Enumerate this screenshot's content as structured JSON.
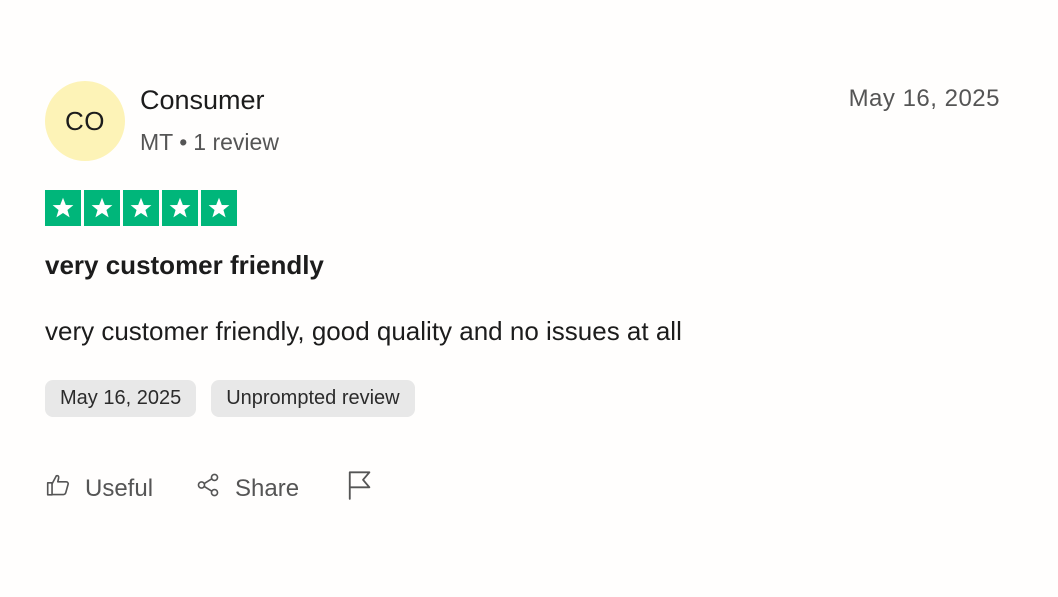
{
  "reviewer": {
    "initials": "CO",
    "name": "Consumer",
    "country": "MT",
    "separator": "•",
    "review_count": "1 review"
  },
  "review": {
    "date": "May 16, 2025",
    "rating": 5,
    "rating_max": 5,
    "star_color": "#00b67a",
    "title": "very customer friendly",
    "body": "very customer friendly, good quality and no issues at all"
  },
  "tags": {
    "experience_date": "May 16, 2025",
    "review_type": "Unprompted review"
  },
  "actions": {
    "useful_label": "Useful",
    "share_label": "Share",
    "useful_icon": "thumbs-up-icon",
    "share_icon": "share-icon",
    "report_icon": "flag-icon"
  },
  "colors": {
    "avatar_bg": "#fdf3b7",
    "tag_bg": "#e8e8e8"
  }
}
